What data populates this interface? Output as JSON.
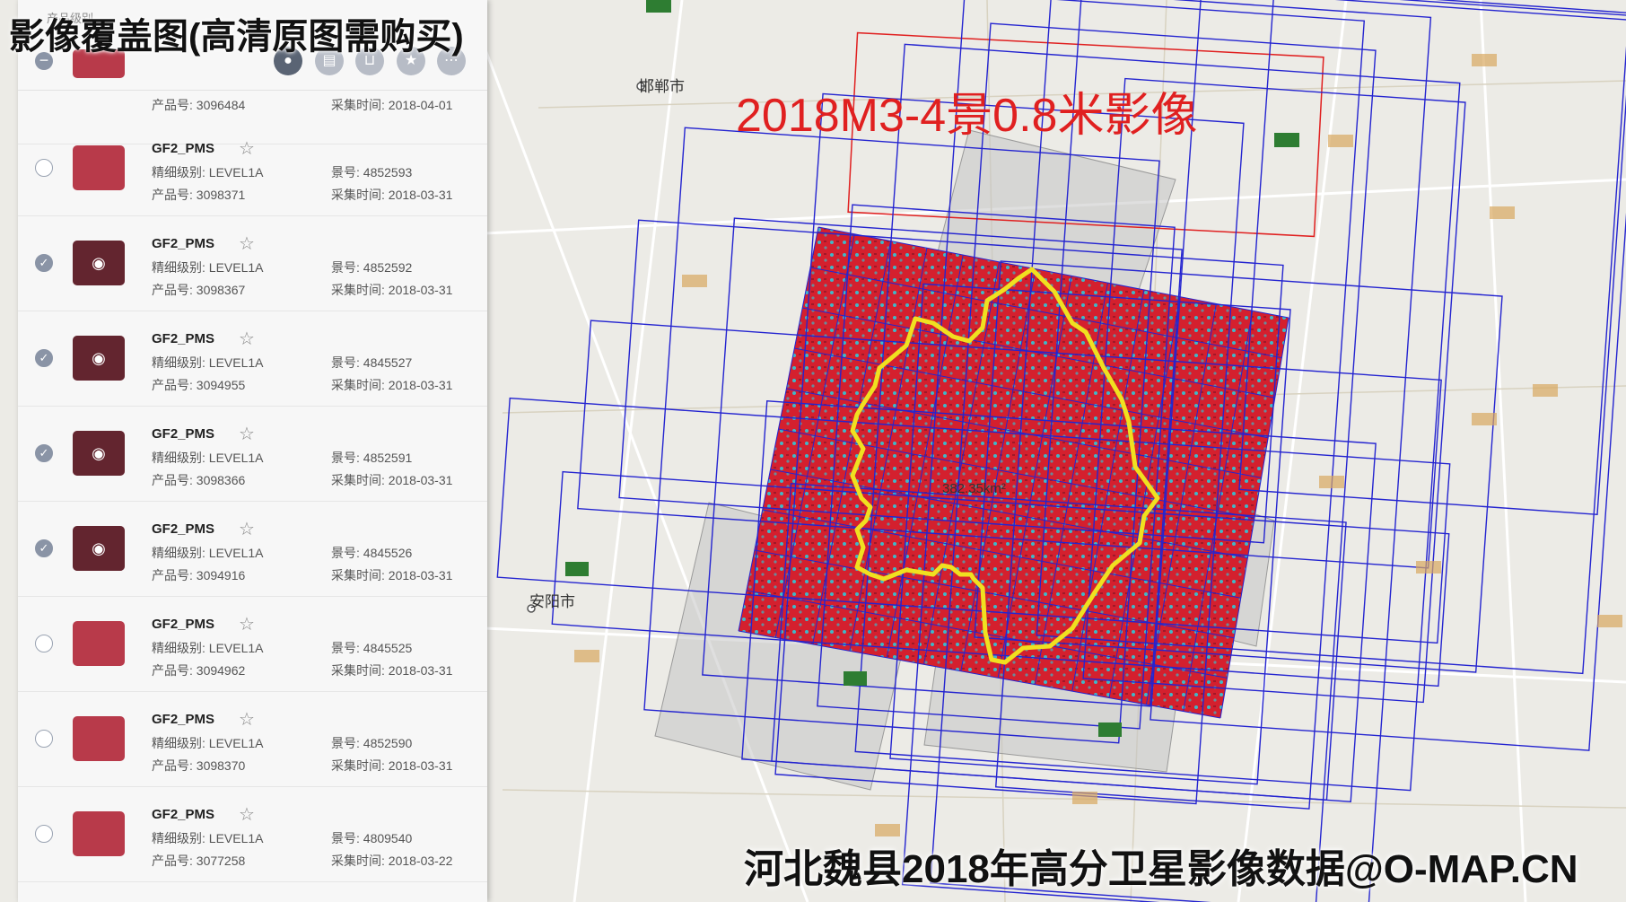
{
  "title": "影像覆盖图(高清原图需购买)",
  "map_label": "2018M3-4景0.8米影像",
  "footer": "河北魏县2018年高分卫星影像数据@O-MAP.CN",
  "area_label": "382.35km²",
  "cities": [
    "邯郸市",
    "安阳市"
  ],
  "panel": {
    "filter_label": "产品级别",
    "tools": [
      "eye-icon",
      "layers-icon",
      "cart-icon",
      "star-icon",
      "more-icon"
    ]
  },
  "items": [
    {
      "name": "",
      "level": "",
      "scene": "",
      "product": "产品号: 3096484",
      "date": "采集时间: 2018-04-01",
      "checked": false,
      "visible": false
    },
    {
      "name": "GF2_PMS",
      "level": "精细级别: LEVEL1A",
      "scene": "景号: 4852593",
      "product": "产品号: 3098371",
      "date": "采集时间: 2018-03-31",
      "checked": false,
      "visible": false
    },
    {
      "name": "GF2_PMS",
      "level": "精细级别: LEVEL1A",
      "scene": "景号: 4852592",
      "product": "产品号: 3098367",
      "date": "采集时间: 2018-03-31",
      "checked": true,
      "visible": true
    },
    {
      "name": "GF2_PMS",
      "level": "精细级别: LEVEL1A",
      "scene": "景号: 4845527",
      "product": "产品号: 3094955",
      "date": "采集时间: 2018-03-31",
      "checked": true,
      "visible": true
    },
    {
      "name": "GF2_PMS",
      "level": "精细级别: LEVEL1A",
      "scene": "景号: 4852591",
      "product": "产品号: 3098366",
      "date": "采集时间: 2018-03-31",
      "checked": true,
      "visible": true
    },
    {
      "name": "GF2_PMS",
      "level": "精细级别: LEVEL1A",
      "scene": "景号: 4845526",
      "product": "产品号: 3094916",
      "date": "采集时间: 2018-03-31",
      "checked": true,
      "visible": true
    },
    {
      "name": "GF2_PMS",
      "level": "精细级别: LEVEL1A",
      "scene": "景号: 4845525",
      "product": "产品号: 3094962",
      "date": "采集时间: 2018-03-31",
      "checked": false,
      "visible": false
    },
    {
      "name": "GF2_PMS",
      "level": "精细级别: LEVEL1A",
      "scene": "景号: 4852590",
      "product": "产品号: 3098370",
      "date": "采集时间: 2018-03-31",
      "checked": false,
      "visible": false
    },
    {
      "name": "GF2_PMS",
      "level": "精细级别: LEVEL1A",
      "scene": "景号: 4809540",
      "product": "产品号: 3077258",
      "date": "采集时间: 2018-03-22",
      "checked": false,
      "visible": false
    }
  ],
  "colors": {
    "boundary": "#f0e020",
    "footprint": "#2424d0",
    "image": "#d4202e",
    "image_alt": "#3fb8c8",
    "accent_red": "#e02020"
  }
}
